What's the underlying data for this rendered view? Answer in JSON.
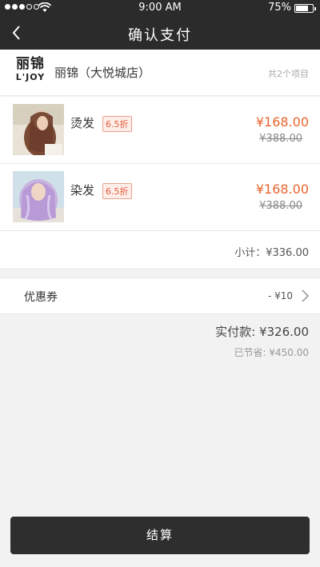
{
  "status_bar": {
    "time": "9:00 AM",
    "battery": "75%",
    "icons": [
      "signal-dots-icon",
      "wifi-icon",
      "battery-icon"
    ]
  },
  "nav": {
    "title": "确认支付",
    "back_icon": "chevron-left-icon"
  },
  "store": {
    "logo_cn": "丽锦",
    "logo_en": "L'JOY",
    "name": "丽锦（大悦城店）",
    "item_count": "共2个项目"
  },
  "items": [
    {
      "name": "烫发",
      "discount": "6.5折",
      "price": "¥168.00",
      "original_price": "¥388.00"
    },
    {
      "name": "染发",
      "discount": "6.5折",
      "price": "¥168.00",
      "original_price": "¥388.00"
    }
  ],
  "subtotal": "小计：¥336.00",
  "coupon": {
    "label": "优惠券",
    "value": "- ¥10",
    "icon": "chevron-right-icon"
  },
  "summary": {
    "paid": "实付款: ¥326.00",
    "saved": "已节省: ¥450.00"
  },
  "checkout_label": "结算",
  "colors": {
    "header": "#2b2b2b",
    "price": "#e8652f",
    "badge": "#e65c3a",
    "button": "#2e2e2e"
  }
}
